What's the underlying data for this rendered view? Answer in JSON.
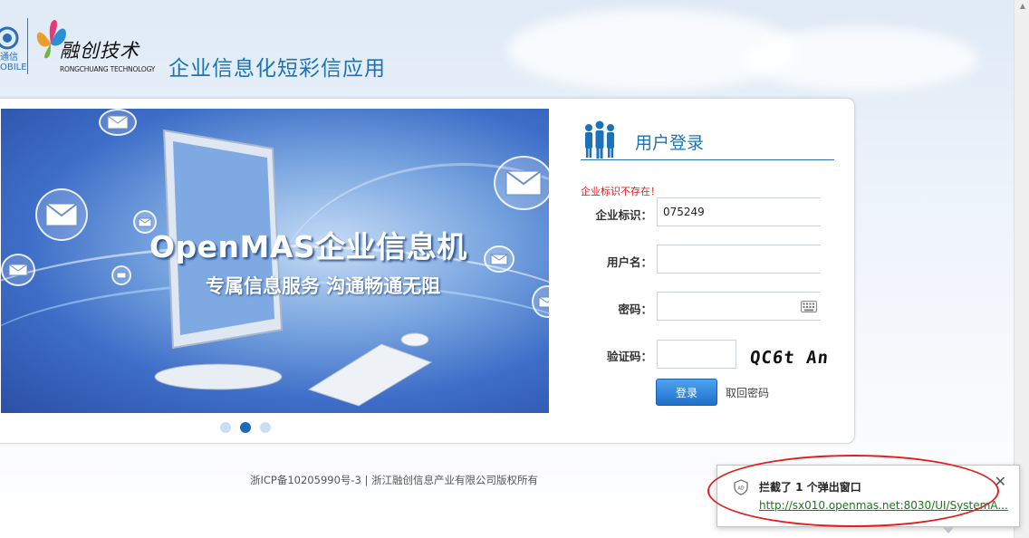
{
  "header": {
    "carrier_logo_text": "通信\nOBILE",
    "partner_logo_script": "融创技术",
    "partner_logo_sub": "RONGCHUANG TECHNOLOGY",
    "app_title": "企业信息化短彩信应用"
  },
  "banner": {
    "headline": "OpenMAS企业信息机",
    "tagline": "专属信息服务 沟通畅通无阻",
    "slide_count": 3,
    "active_slide": 2
  },
  "login": {
    "title": "用户登录",
    "error_message": "企业标识不存在！",
    "fields": {
      "enterprise_id": {
        "label": "企业标识：",
        "value": "075249"
      },
      "username": {
        "label": "用户名：",
        "value": ""
      },
      "password": {
        "label": "密码：",
        "value": ""
      },
      "captcha": {
        "label": "验证码：",
        "value": "",
        "image_text": "QC6t An"
      }
    },
    "submit_label": "登录",
    "forgot_label": "取回密码"
  },
  "footer": {
    "text": "浙ICP备10205990号-3 | 浙江融创信息产业有限公司版权所有"
  },
  "popup_blocker": {
    "title": "拦截了 1 个弹出窗口",
    "link": "http://sx010.openmas.net:8030/UI/SystemA..."
  },
  "colors": {
    "brand_blue": "#1a73b8",
    "error_red": "#e41e1e",
    "button_blue": "#1e6fcc",
    "annotation_red": "#e02020",
    "link_green": "#1b7a1b"
  },
  "icons": [
    "users-icon",
    "keyboard-icon",
    "mail-icon",
    "shield-icon",
    "close-icon"
  ]
}
